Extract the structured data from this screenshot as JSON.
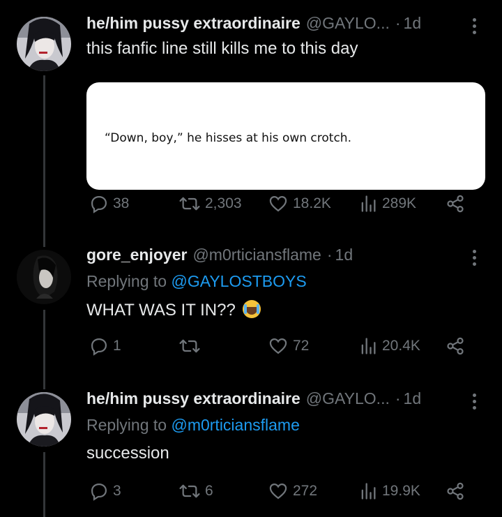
{
  "tweets": [
    {
      "name": "he/him pussy extraordinaire",
      "handle": "@GAYLO...",
      "dot": "·",
      "time": "1d",
      "text": "this fanfic line still kills me to this day",
      "card_text": "“Down, boy,” he hisses at his own crotch.",
      "replies": "38",
      "retweets": "2,303",
      "likes": "18.2K",
      "views": "289K"
    },
    {
      "name": "gore_enjoyer",
      "handle": "@m0rticiansflame",
      "dot": "·",
      "time": "1d",
      "replying_prefix": "Replying to",
      "replying_to": "@GAYLOSTBOYS",
      "text": "WHAT WAS IT IN??",
      "emoji": "loudly-crying-face",
      "replies": "1",
      "retweets": "",
      "likes": "72",
      "views": "20.4K"
    },
    {
      "name": "he/him pussy extraordinaire",
      "handle": "@GAYLO...",
      "dot": "·",
      "time": "1d",
      "replying_prefix": "Replying to",
      "replying_to": "@m0rticiansflame",
      "text": "succession",
      "replies": "3",
      "retweets": "6",
      "likes": "272",
      "views": "19.9K"
    }
  ],
  "colors": {
    "background": "#000000",
    "text": "#e7e9ea",
    "muted": "#71767b",
    "link": "#1d9bf0",
    "thread_line": "#333639"
  }
}
